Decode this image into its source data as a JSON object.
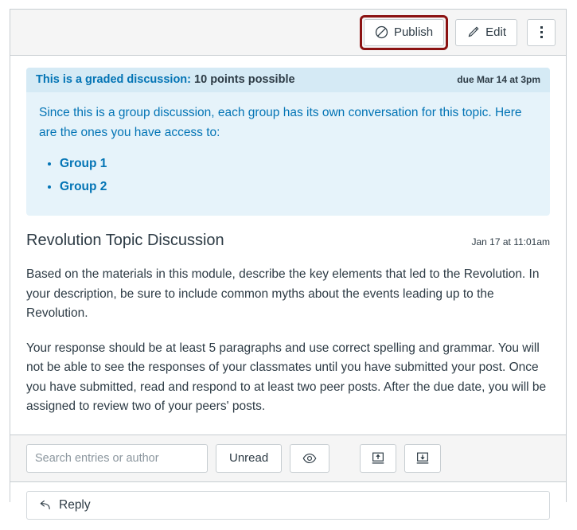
{
  "toolbar": {
    "publish_label": "Publish",
    "publish_icon": "unpublished-circle-slash-icon",
    "edit_label": "Edit",
    "edit_icon": "pencil-icon",
    "kebab_icon": "more-options-vertical-dots-icon",
    "publish_focus_color": "#8b1212"
  },
  "info_banner": {
    "graded_label": "This is a graded discussion:",
    "points_label": "10 points possible",
    "due_label": "due Mar 14 at 3pm",
    "body_text": "Since this is a group discussion, each group has its own conversation for this topic. Here are the ones you have access to:",
    "groups": [
      {
        "label": "Group 1"
      },
      {
        "label": "Group 2"
      }
    ],
    "accent_color": "#0374b5",
    "background_color": "#e6f3fa",
    "header_background_color": "#d5eaf5"
  },
  "topic": {
    "title": "Revolution Topic Discussion",
    "posted_at": "Jan 17 at 11:01am",
    "paragraphs": [
      "Based on the materials in this module, describe the key elements that led to the Revolution. In your description, be sure to include common myths about the events leading up to the Revolution.",
      "Your response should be at least 5 paragraphs and use correct spelling and grammar. You will not be able to see the responses of your classmates until you have submitted your post. Once you have submitted, read and respond to at least two peer posts. After the due date, you will be assigned to review two of your peers' posts."
    ]
  },
  "filter_bar": {
    "search_value": "",
    "search_placeholder": "Search entries or author",
    "unread_label": "Unread",
    "eye_icon": "eye-visibility-icon",
    "collapse_icon": "collapse-threads-arrow-up-icon",
    "expand_icon": "expand-threads-arrow-down-icon"
  },
  "reply": {
    "label": "Reply",
    "icon": "reply-arrow-icon"
  }
}
